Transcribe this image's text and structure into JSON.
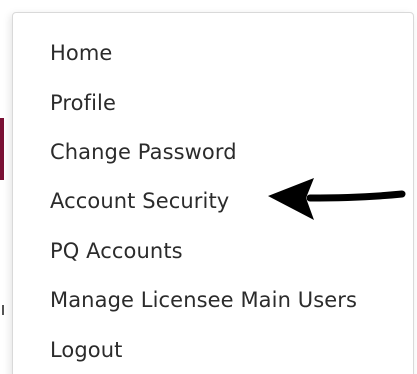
{
  "menu": {
    "items": [
      {
        "label": "Home"
      },
      {
        "label": "Profile"
      },
      {
        "label": "Change Password"
      },
      {
        "label": "Account Security"
      },
      {
        "label": "PQ Accounts"
      },
      {
        "label": "Manage Licensee Main Users"
      },
      {
        "label": "Logout"
      }
    ]
  },
  "annotation": {
    "icon": "left-arrow-icon",
    "color": "#000000",
    "points_to": "Account Security"
  },
  "colors": {
    "text": "#2b2b2b",
    "menu_border": "#d9d9d9",
    "background_accent": "#7a1034"
  }
}
